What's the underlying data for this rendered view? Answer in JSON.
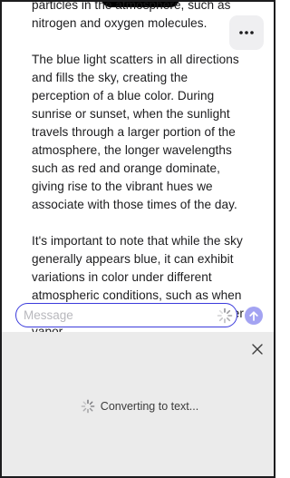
{
  "article": {
    "paragraphs": [
      "particles in the atmosphere, such as nitrogen and oxygen molecules.",
      "The blue light scatters in all directions and fills the sky, creating the perception of a blue color. During sunrise or sunset, when the sunlight travels through a larger portion of the atmosphere, the longer wavelengths such as red and orange dominate, giving rise to the vibrant hues we associate with those times of the day.",
      "It's important to note that while the sky generally appears blue, it can exhibit variations in color under different atmospheric conditions, such as when influenced by pollutants, dust, or water vapor."
    ]
  },
  "toolbar": {
    "more_icon": "ellipsis-icon"
  },
  "composer": {
    "placeholder": "Message",
    "value": "",
    "loading_icon": "spinner-icon",
    "send_icon": "arrow-up-icon"
  },
  "dictation_panel": {
    "status": "Converting to text...",
    "close_icon": "close-icon",
    "status_icon": "spinner-icon"
  },
  "colors": {
    "accent": "#3b3bdc",
    "send_button": "#a3a3f2",
    "panel_background": "#ebebeb"
  }
}
